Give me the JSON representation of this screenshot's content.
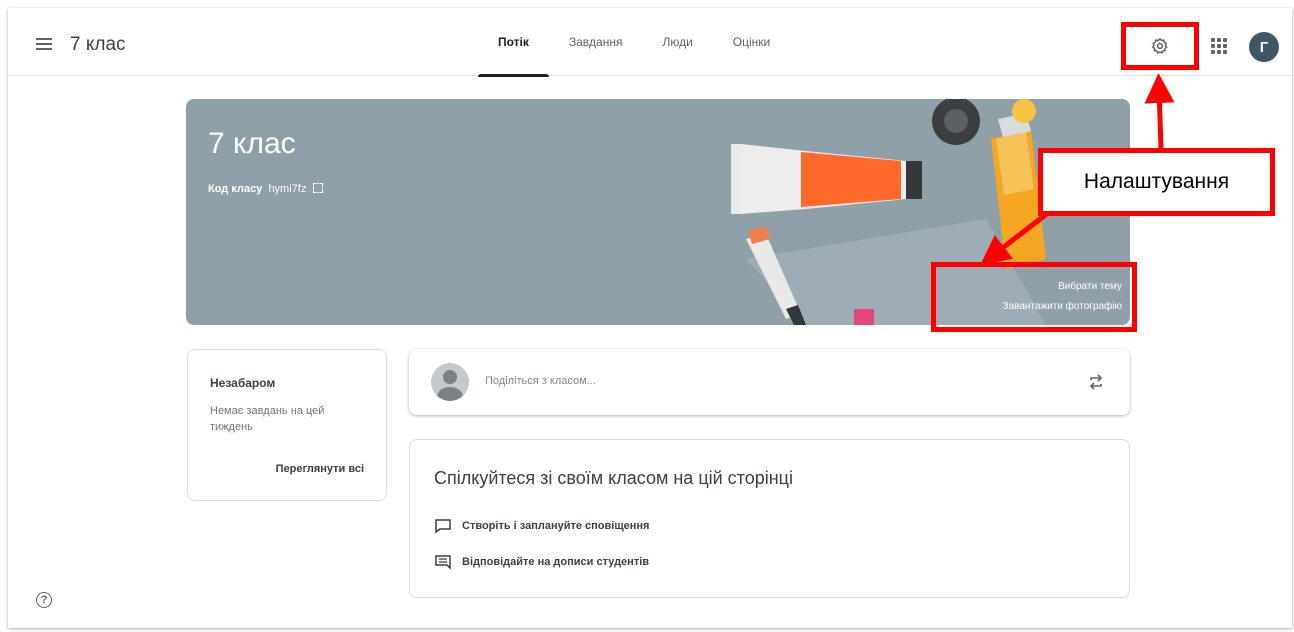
{
  "header": {
    "class_title": "7 клас",
    "tabs": [
      {
        "label": "Потік",
        "active": true
      },
      {
        "label": "Завдання",
        "active": false
      },
      {
        "label": "Люди",
        "active": false
      },
      {
        "label": "Оцінки",
        "active": false
      }
    ],
    "avatar_letter": "Г"
  },
  "banner": {
    "title": "7 клас",
    "class_code_label": "Код класу",
    "class_code_value": "hymi7fz",
    "select_theme": "Вибрати тему",
    "upload_photo": "Завантажити фотографію",
    "background_color": "#8fa0a9"
  },
  "annotation": {
    "callout_text": "Налаштування",
    "highlight_color": "#ff0000"
  },
  "upcoming": {
    "title": "Незабаром",
    "text": "Немає завдань на цей тиждень",
    "view_all": "Переглянути всі"
  },
  "share": {
    "placeholder": "Поділіться з класом..."
  },
  "communicate": {
    "title": "Спілкуйтеся зі своїм класом на цій сторінці",
    "items": [
      {
        "label": "Створіть і заплануйте сповіщення",
        "icon": "announcement-icon"
      },
      {
        "label": "Відповідайте на дописи студентів",
        "icon": "comment-icon"
      }
    ]
  },
  "icons": {
    "menu": "menu-icon",
    "settings": "gear-icon",
    "apps": "apps-grid-icon",
    "repost": "repost-icon",
    "help": "help-icon"
  }
}
